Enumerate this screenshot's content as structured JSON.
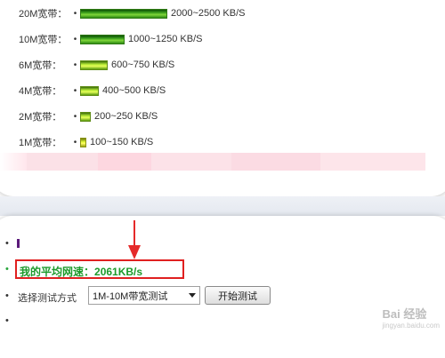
{
  "bandwidth_rows": [
    {
      "label": "20M宽带：",
      "bullet": "•",
      "value": "2000~2500 KB/S",
      "bar_fraction": 1.0,
      "style": "green"
    },
    {
      "label": "10M宽带：",
      "bullet": "•",
      "value": "1000~1250 KB/S",
      "bar_fraction": 0.5,
      "style": "green"
    },
    {
      "label": "6M宽带：",
      "bullet": "•",
      "value": "600~750 KB/S",
      "bar_fraction": 0.3,
      "style": "lime"
    },
    {
      "label": "4M宽带：",
      "bullet": "•",
      "value": "400~500 KB/S",
      "bar_fraction": 0.2,
      "style": "lime"
    },
    {
      "label": "2M宽带：",
      "bullet": "•",
      "value": "200~250  KB/S",
      "bar_fraction": 0.1,
      "style": "lime"
    },
    {
      "label": "1M宽带：",
      "bullet": "•",
      "value": "100~150  KB/S",
      "bar_fraction": 0.05,
      "style": "yellow"
    }
  ],
  "result": {
    "label": "我的平均网速：",
    "value": "2061KB/s",
    "bullet": "•"
  },
  "test_mode": {
    "label": "选择测试方式",
    "selected": "1M-10M带宽测试",
    "start_button": "开始测试",
    "bullet": "•"
  },
  "extra_bullets": [
    "•",
    "•"
  ],
  "watermark": {
    "logo": "Bai 经验",
    "sub": "jingyan.baidu.com"
  },
  "colors": {
    "accent_green": "#1c9a2a",
    "highlight_red": "#e02020"
  }
}
